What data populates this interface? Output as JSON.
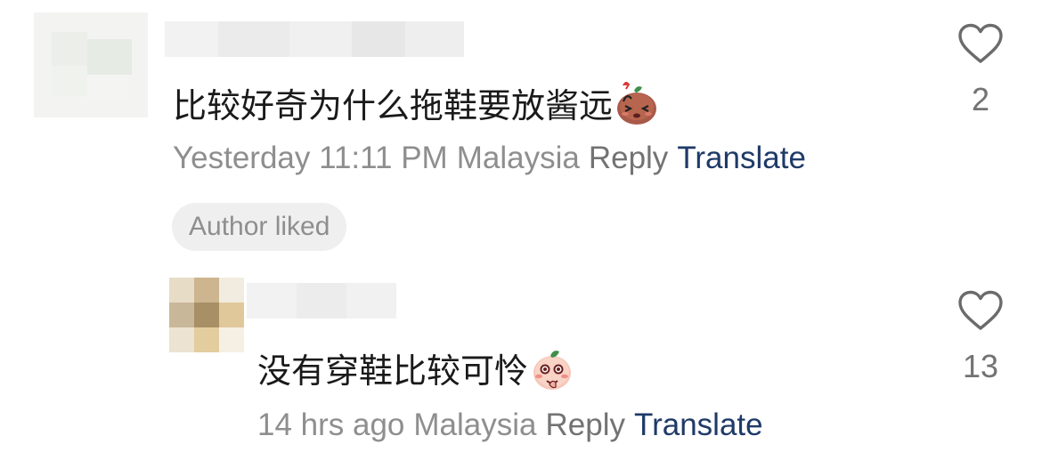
{
  "comments": [
    {
      "text": "比较好奇为什么拖鞋要放酱远",
      "emoji": "confused-sweet-potato-emoji",
      "time": "Yesterday 11:11 PM",
      "location": "Malaysia",
      "reply_label": "Reply",
      "translate_label": "Translate",
      "badge": "Author liked",
      "like_count": "2",
      "like_icon": "heart-outline-icon"
    },
    {
      "text": "没有穿鞋比较可怜",
      "emoji": "shy-peach-emoji",
      "time": "14 hrs ago",
      "location": "Malaysia",
      "reply_label": "Reply",
      "translate_label": "Translate",
      "like_count": "13",
      "like_icon": "heart-outline-icon"
    }
  ],
  "colors": {
    "meta_text": "#8e8e8e",
    "translate_link": "#1f3a68",
    "badge_bg": "#efefef"
  }
}
